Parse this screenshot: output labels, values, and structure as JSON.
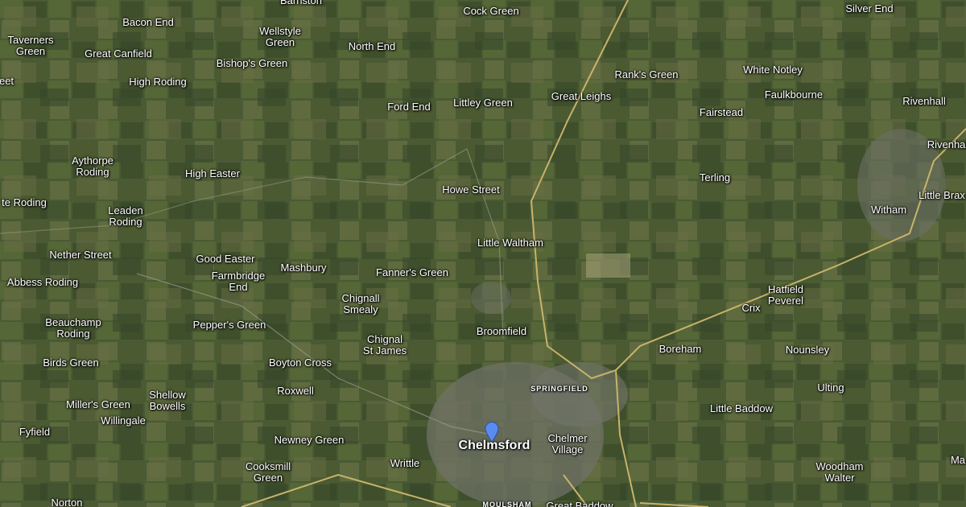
{
  "map": {
    "pin_color": "#5a8cf0",
    "places": {
      "barnston": "Barnston",
      "cock_green": "Cock Green",
      "silver_end": "Silver End",
      "taverners_green": "Taverners\nGreen",
      "bacon_end": "Bacon End",
      "wellstyle_green": "Wellstyle\nGreen",
      "north_end": "North End",
      "great_canfield": "Great Canfield",
      "bishops_green": "Bishop's Green",
      "high_roding": "High Roding",
      "white_notley": "White Notley",
      "ranks_green": "Rank's Green",
      "faulkbourne": "Faulkbourne",
      "great_leighs": "Great Leighs",
      "littley_green": "Littley Green",
      "ford_end": "Ford End",
      "fairstead": "Fairstead",
      "rivenhall": "Rivenhall",
      "rivenhall_end": "Rivenhal",
      "aythorpe_roding": "Aythorpe\nRoding",
      "high_easter": "High Easter",
      "terling": "Terling",
      "howe_street": "Howe Street",
      "white_roding": "te Roding",
      "leaden_roding": "Leaden\nRoding",
      "witham": "Witham",
      "little_braxted": "Little Brax",
      "little_waltham": "Little Waltham",
      "nether_street": "Nether Street",
      "good_easter": "Good Easter",
      "mashbury": "Mashbury",
      "fanners_green": "Fanner's Green",
      "farmbridge_end": "Farmbridge\nEnd",
      "abbess_roding": "Abbess Roding",
      "hatfield_peverel": "Hatfield\nPeverel",
      "chignall_smealy": "Chignall\nSmealy",
      "crix": "Crix",
      "beauchamp_roding": "Beauchamp\nRoding",
      "peppers_green": "Pepper's Green",
      "broomfield": "Broomfield",
      "chignal_st_james": "Chignal\nSt James",
      "boreham": "Boreham",
      "nounsley": "Nounsley",
      "birds_green": "Birds Green",
      "boyton_cross": "Boyton Cross",
      "springfield": "SPRINGFIELD",
      "roxwell": "Roxwell",
      "ulting": "Ulting",
      "shellow_bowells": "Shellow\nBowells",
      "millers_green": "Miller's Green",
      "little_baddow": "Little Baddow",
      "willingale": "Willingale",
      "fyfield": "Fyfield",
      "chelmer_village": "Chelmer\nVillage",
      "newney_green": "Newney Green",
      "chelmsford": "Chelmsford",
      "writtle": "Writtle",
      "cooksmill_green": "Cooksmill\nGreen",
      "woodham_walter": "Woodham\nWalter",
      "ma": "Ma",
      "norton": "Norton",
      "moulsham": "MOULSHAM",
      "great_baddow": "Great Baddow",
      "eet": "eet"
    }
  }
}
